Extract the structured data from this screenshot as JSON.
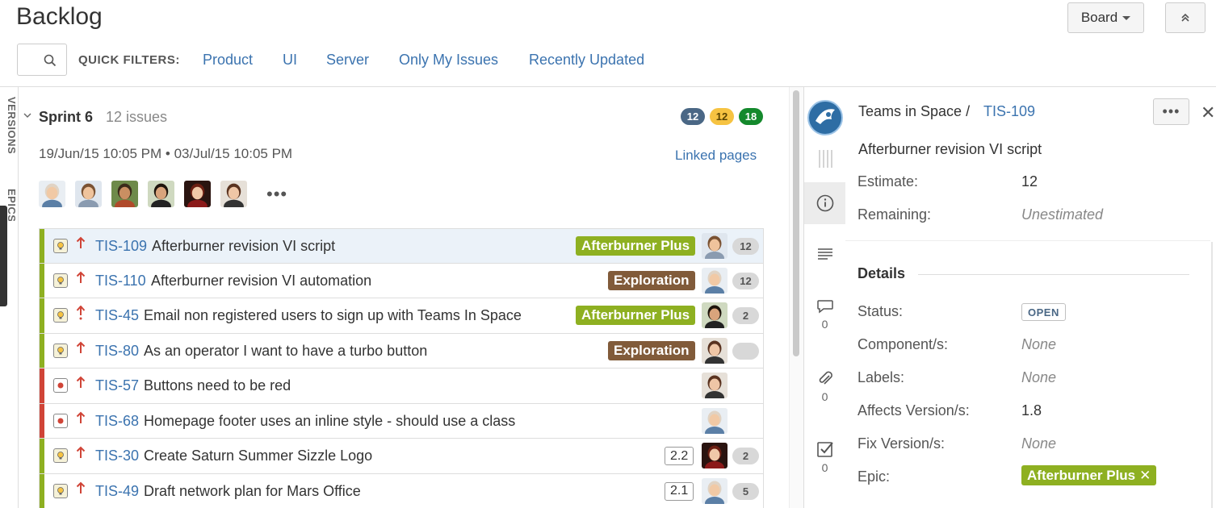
{
  "header": {
    "title": "Backlog",
    "board_label": "Board"
  },
  "quick_filters": {
    "label": "QUICK FILTERS:",
    "items": [
      "Product",
      "UI",
      "Server",
      "Only My Issues",
      "Recently Updated"
    ]
  },
  "side_tabs": {
    "versions": "VERSIONS",
    "epics": "EPICS"
  },
  "sprint": {
    "name": "Sprint 6",
    "issue_count": "12 issues",
    "badges": [
      {
        "value": "12",
        "color": "#4a6785"
      },
      {
        "value": "12",
        "color": "#f6c342"
      },
      {
        "value": "18",
        "color": "#14892c"
      }
    ],
    "start": "19/Jun/15 10:05 PM",
    "separator": "•",
    "end": "03/Jul/15 10:05 PM",
    "linked_pages": "Linked pages",
    "more": "•••"
  },
  "issues": [
    {
      "key": "TIS-109",
      "summary": "Afterburner revision VI script",
      "type": "story",
      "priority": "high",
      "epic": "Afterburner Plus",
      "epic_color": "#8eb021",
      "estimate": "",
      "points": "12",
      "bar": "#8eb021",
      "avatar": "man-smile",
      "selected": true
    },
    {
      "key": "TIS-110",
      "summary": "Afterburner revision VI automation",
      "type": "story",
      "priority": "high",
      "epic": "Exploration",
      "epic_color": "#815b3a",
      "estimate": "",
      "points": "12",
      "bar": "#8eb021",
      "avatar": "man-bald",
      "selected": false
    },
    {
      "key": "TIS-45",
      "summary": "Email non registered users to sign up with Teams In Space",
      "type": "story",
      "priority": "highest",
      "epic": "Afterburner Plus",
      "epic_color": "#8eb021",
      "estimate": "",
      "points": "2",
      "bar": "#8eb021",
      "avatar": "woman-dark",
      "selected": false
    },
    {
      "key": "TIS-80",
      "summary": "As an operator I want to have a turbo button",
      "type": "story",
      "priority": "high",
      "epic": "Exploration",
      "epic_color": "#815b3a",
      "estimate": "",
      "points": "",
      "bar": "#8eb021",
      "avatar": "woman-brown",
      "selected": false
    },
    {
      "key": "TIS-57",
      "summary": "Buttons need to be red",
      "type": "bug",
      "priority": "high",
      "epic": "",
      "epic_color": "",
      "estimate": "",
      "points": "",
      "bar": "#d04437",
      "avatar": "woman-brown",
      "selected": false
    },
    {
      "key": "TIS-68",
      "summary": "Homepage footer uses an inline style - should use a class",
      "type": "bug",
      "priority": "high",
      "epic": "",
      "epic_color": "",
      "estimate": "",
      "points": "",
      "bar": "#d04437",
      "avatar": "man-bald",
      "selected": false
    },
    {
      "key": "TIS-30",
      "summary": "Create Saturn Summer Sizzle Logo",
      "type": "story",
      "priority": "high",
      "epic": "",
      "epic_color": "",
      "estimate": "2.2",
      "points": "2",
      "bar": "#8eb021",
      "avatar": "woman-red",
      "selected": false
    },
    {
      "key": "TIS-49",
      "summary": "Draft network plan for Mars Office",
      "type": "story",
      "priority": "high",
      "epic": "",
      "epic_color": "",
      "estimate": "2.1",
      "points": "5",
      "bar": "#8eb021",
      "avatar": "man-bald",
      "selected": false
    }
  ],
  "detail": {
    "project": "Teams in Space",
    "path_sep": "/",
    "key": "TIS-109",
    "more": "•••",
    "close": "✕",
    "summary": "Afterburner revision VI script",
    "estimate_label": "Estimate:",
    "estimate_value": "12",
    "remaining_label": "Remaining:",
    "remaining_value": "Unestimated",
    "details_heading": "Details",
    "status_label": "Status:",
    "status_value": "OPEN",
    "components_label": "Component/s:",
    "components_value": "None",
    "labels_label": "Labels:",
    "labels_value": "None",
    "affects_label": "Affects Version/s:",
    "affects_value": "1.8",
    "fix_label": "Fix Version/s:",
    "fix_value": "None",
    "epic_label": "Epic:",
    "epic_value": "Afterburner Plus",
    "epic_remove": "✕",
    "comments_count": "0",
    "attachments_count": "0",
    "subtasks_count": "0"
  }
}
